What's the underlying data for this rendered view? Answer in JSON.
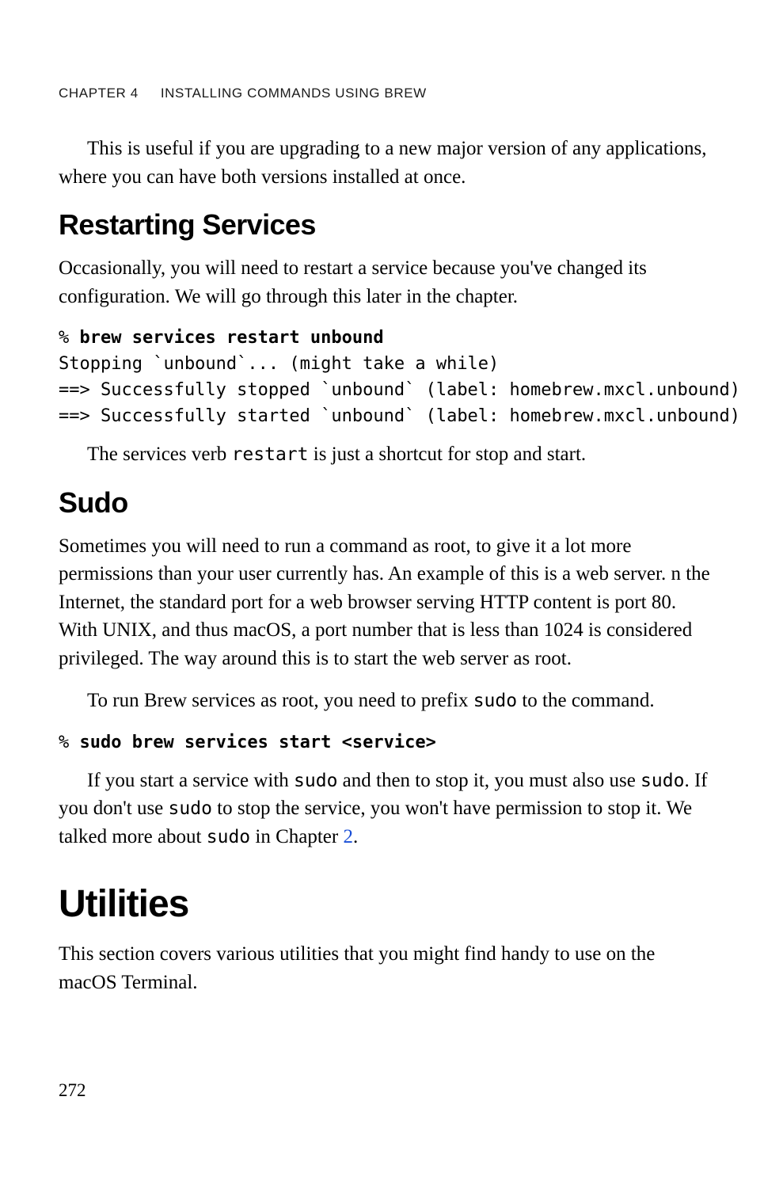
{
  "header": {
    "chapter": "CHAPTER 4",
    "title": "INSTALLING COMMANDS USING BREW"
  },
  "intro_p": "This is useful if you are upgrading to a new major version of any applications, where you can have both versions installed at once.",
  "restarting": {
    "heading": "Restarting Services",
    "p1": "Occasionally, you will need to restart a service because you've changed its configuration. We will go through this later in the chapter.",
    "code_prompt": "% ",
    "code_cmd": "brew services restart unbound",
    "code_out_l1": "Stopping `unbound`... (might take a while)",
    "code_out_l2": "==> Successfully stopped `unbound` (label: homebrew.mxcl.unbound)",
    "code_out_l3": "==> Successfully started `unbound` (label: homebrew.mxcl.unbound)",
    "p2_a": "The services verb ",
    "p2_code": "restart",
    "p2_b": " is just a shortcut for stop and start."
  },
  "sudo": {
    "heading": "Sudo",
    "p1": "Sometimes you will need to run a command as root, to give it a lot more permissions than your user currently has. An example of this is a web server. n the Internet, the standard port for a web browser serving HTTP content is port 80. With UNIX, and thus macOS, a port number that is less than 1024 is considered privileged. The way around this is to start the web server as root.",
    "p2_a": "To run Brew services as root, you need to prefix ",
    "p2_code": "sudo",
    "p2_b": " to the command.",
    "code_prompt": "% ",
    "code_cmd": "sudo brew services start <service>",
    "p3_a": "If you start a service with ",
    "p3_c1": "sudo",
    "p3_b": " and then to stop it, you must also use ",
    "p3_c2": "sudo",
    "p3_c": ". If you don't use ",
    "p3_c3": "sudo",
    "p3_d": " to stop the service, you won't have permission to stop it. We talked more about ",
    "p3_c4": "sudo",
    "p3_e": " in Chapter ",
    "p3_link": "2",
    "p3_f": "."
  },
  "utilities": {
    "heading": "Utilities",
    "p1": "This section covers various utilities that you might find handy to use on the macOS Terminal."
  },
  "page_number": "272"
}
